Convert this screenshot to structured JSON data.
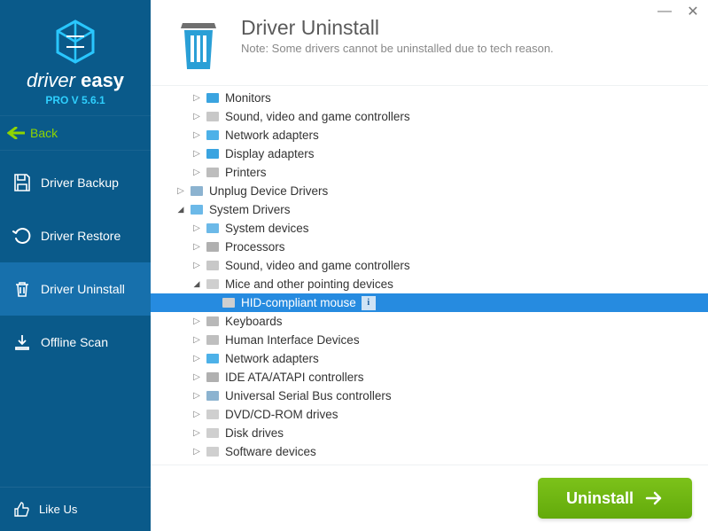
{
  "app": {
    "logo_line1": "driver",
    "logo_line2": "easy",
    "version": "PRO V 5.6.1"
  },
  "back": {
    "label": "Back"
  },
  "nav": {
    "backup": "Driver Backup",
    "restore": "Driver Restore",
    "uninstall": "Driver Uninstall",
    "offline": "Offline Scan"
  },
  "like": {
    "label": "Like Us"
  },
  "header": {
    "title": "Driver Uninstall",
    "note": "Note: Some drivers cannot be uninstalled due to tech reason."
  },
  "tree": [
    {
      "depth": 1,
      "expand": "closed",
      "icon": "mon",
      "label": "Monitors"
    },
    {
      "depth": 1,
      "expand": "closed",
      "icon": "gen",
      "label": "Sound, video and game controllers"
    },
    {
      "depth": 1,
      "expand": "closed",
      "icon": "net",
      "label": "Network adapters"
    },
    {
      "depth": 1,
      "expand": "closed",
      "icon": "mon",
      "label": "Display adapters"
    },
    {
      "depth": 1,
      "expand": "closed",
      "icon": "prn",
      "label": "Printers"
    },
    {
      "depth": 0,
      "expand": "closed",
      "icon": "usb",
      "label": "Unplug Device Drivers"
    },
    {
      "depth": 0,
      "expand": "open",
      "icon": "sys",
      "label": "System Drivers"
    },
    {
      "depth": 1,
      "expand": "closed",
      "icon": "sys",
      "label": "System devices"
    },
    {
      "depth": 1,
      "expand": "closed",
      "icon": "cpu",
      "label": "Processors"
    },
    {
      "depth": 1,
      "expand": "closed",
      "icon": "gen",
      "label": "Sound, video and game controllers"
    },
    {
      "depth": 1,
      "expand": "open",
      "icon": "mouse",
      "label": "Mice and other pointing devices"
    },
    {
      "depth": 2,
      "expand": "none",
      "icon": "mouse",
      "label": "HID-compliant mouse",
      "selected": true,
      "info": true
    },
    {
      "depth": 1,
      "expand": "closed",
      "icon": "kbd",
      "label": "Keyboards"
    },
    {
      "depth": 1,
      "expand": "closed",
      "icon": "hid",
      "label": "Human Interface Devices"
    },
    {
      "depth": 1,
      "expand": "closed",
      "icon": "net",
      "label": "Network adapters"
    },
    {
      "depth": 1,
      "expand": "closed",
      "icon": "ide",
      "label": "IDE ATA/ATAPI controllers"
    },
    {
      "depth": 1,
      "expand": "closed",
      "icon": "usb",
      "label": "Universal Serial Bus controllers"
    },
    {
      "depth": 1,
      "expand": "closed",
      "icon": "dvd",
      "label": "DVD/CD-ROM drives"
    },
    {
      "depth": 1,
      "expand": "closed",
      "icon": "disk",
      "label": "Disk drives"
    },
    {
      "depth": 1,
      "expand": "closed",
      "icon": "disk",
      "label": "Software devices"
    }
  ],
  "footer": {
    "uninstall_label": "Uninstall"
  }
}
